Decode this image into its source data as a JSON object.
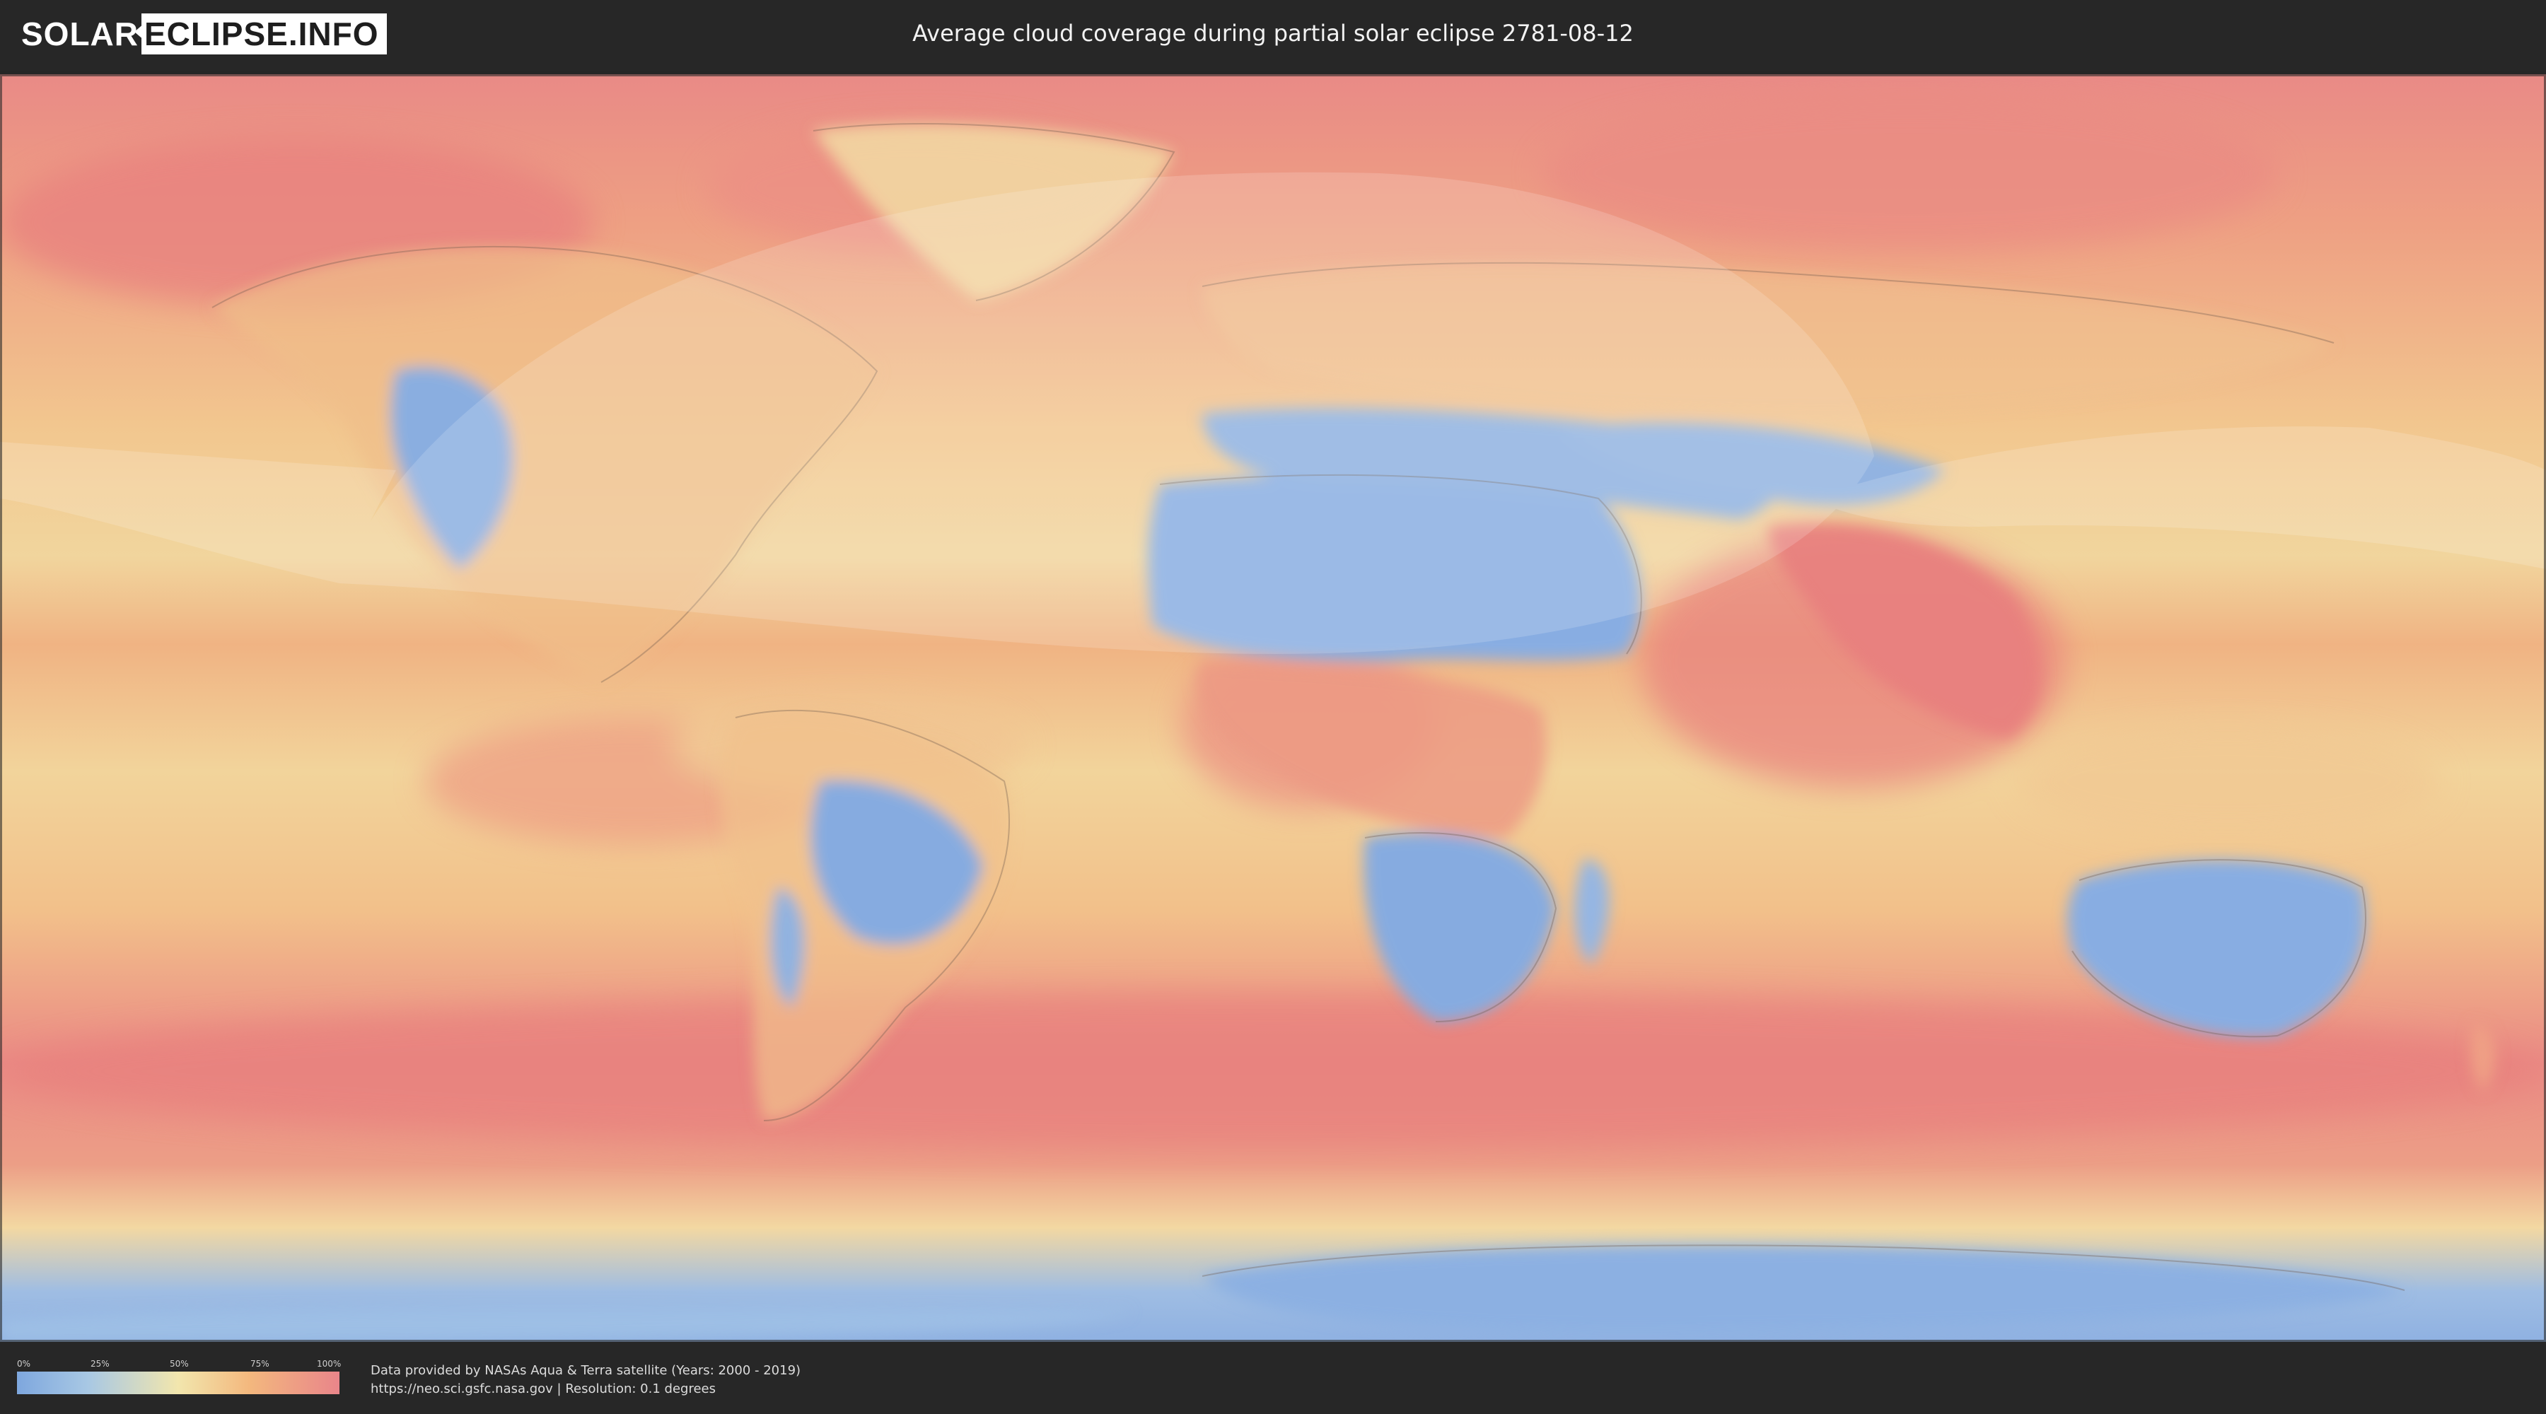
{
  "header": {
    "logo_part1": "SOLAR",
    "logo_part2": "ECLIPSE.INFO",
    "title": "Average cloud coverage during partial solar eclipse 2781-08-12"
  },
  "map": {
    "type": "cloud-coverage world map",
    "projection": "equirectangular",
    "overlay": "partial solar eclipse visibility zone",
    "colors": {
      "clear": "#7ea7de",
      "low": "#a8c8e4",
      "mid": "#f2e6ad",
      "high": "#f3b87e",
      "overcast": "#e9858a",
      "eclipse_overlay": "#ffffff"
    }
  },
  "legend": {
    "ticks": [
      "0%",
      "25%",
      "50%",
      "75%",
      "100%"
    ]
  },
  "credits": {
    "line1": "Data provided by NASAs Aqua & Terra satellite (Years: 2000 - 2019)",
    "line2": "https://neo.sci.gsfc.nasa.gov | Resolution: 0.1 degrees"
  }
}
